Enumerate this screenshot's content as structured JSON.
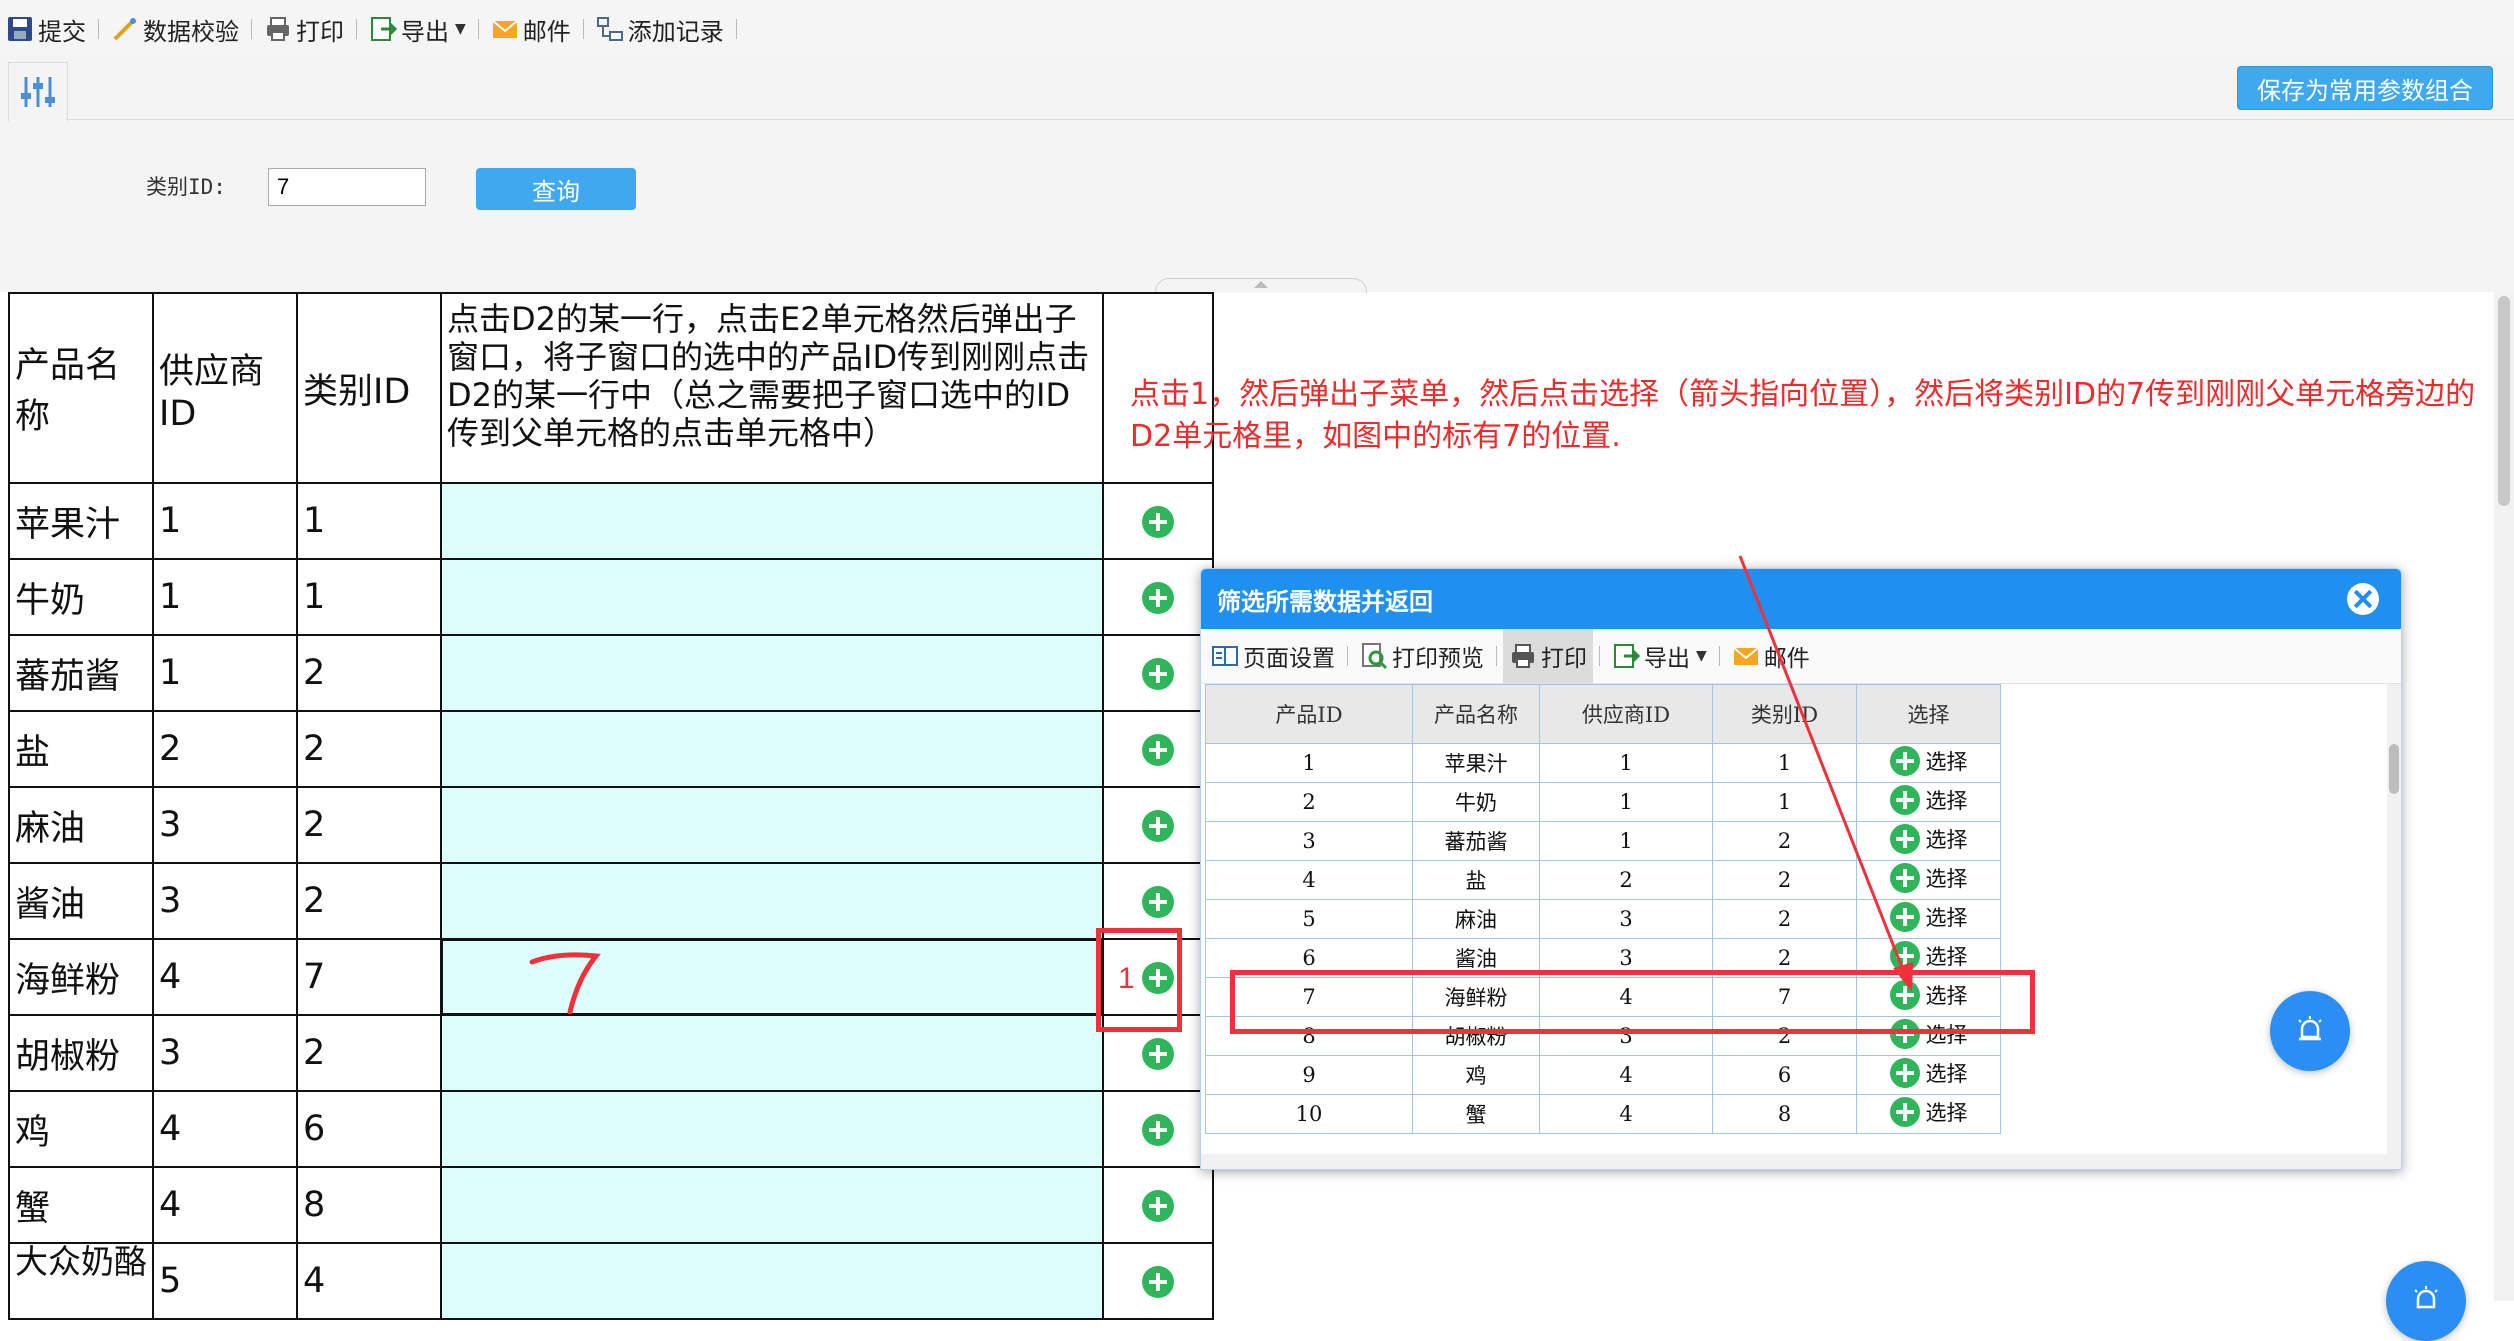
{
  "toolbar": {
    "items": [
      {
        "label": "提交",
        "icon": "save-icon"
      },
      {
        "label": "数据校验",
        "icon": "wand-icon"
      },
      {
        "label": "打印",
        "icon": "printer-icon"
      },
      {
        "label": "导出",
        "icon": "export-icon"
      },
      {
        "label": "邮件",
        "icon": "mail-icon"
      },
      {
        "label": "添加记录",
        "icon": "add-record-icon"
      }
    ]
  },
  "params": {
    "save_label": "保存为常用参数组合",
    "category_label": "类别ID:",
    "category_value": "7",
    "query_label": "查询"
  },
  "main_table": {
    "headers": [
      "产品名称",
      "供应商ID",
      "类别ID",
      "点击D2的某一行，点击E2单元格然后弹出子窗口，将子窗口的选中的产品ID传到刚刚点击D2的某一行中（总之需要把子窗口选中的ID传到父单元格的点击单元格中）",
      ""
    ],
    "rows": [
      [
        "苹果汁",
        "1",
        "1"
      ],
      [
        "牛奶",
        "1",
        "1"
      ],
      [
        "蕃茄酱",
        "1",
        "2"
      ],
      [
        "盐",
        "2",
        "2"
      ],
      [
        "麻油",
        "3",
        "2"
      ],
      [
        "酱油",
        "3",
        "2"
      ],
      [
        "海鲜粉",
        "4",
        "7"
      ],
      [
        "胡椒粉",
        "3",
        "2"
      ],
      [
        "鸡",
        "4",
        "6"
      ],
      [
        "蟹",
        "4",
        "8"
      ],
      [
        "大众奶酪",
        "5",
        "4"
      ]
    ]
  },
  "annotation": {
    "text": "点击1，然后弹出子菜单，然后点击选择（箭头指向位置），然后将类别ID的7传到刚刚父单元格旁边的D2单元格里，如图中的标有7的位置.",
    "marker_number": "1",
    "handwritten": "7"
  },
  "dialog": {
    "title": "筛选所需数据并返回",
    "toolbar": [
      {
        "label": "页面设置",
        "icon": "page-setup-icon"
      },
      {
        "label": "打印预览",
        "icon": "print-preview-icon"
      },
      {
        "label": "打印",
        "icon": "printer-icon"
      },
      {
        "label": "导出",
        "icon": "export-icon"
      },
      {
        "label": "邮件",
        "icon": "mail-icon"
      }
    ],
    "headers": [
      "产品ID",
      "产品名称",
      "供应商ID",
      "类别ID",
      "选择"
    ],
    "select_label": "选择",
    "rows": [
      [
        "1",
        "苹果汁",
        "1",
        "1"
      ],
      [
        "2",
        "牛奶",
        "1",
        "1"
      ],
      [
        "3",
        "蕃茄酱",
        "1",
        "2"
      ],
      [
        "4",
        "盐",
        "2",
        "2"
      ],
      [
        "5",
        "麻油",
        "3",
        "2"
      ],
      [
        "6",
        "酱油",
        "3",
        "2"
      ],
      [
        "7",
        "海鲜粉",
        "4",
        "7"
      ],
      [
        "8",
        "胡椒粉",
        "3",
        "2"
      ],
      [
        "9",
        "鸡",
        "4",
        "6"
      ],
      [
        "10",
        "蟹",
        "4",
        "8"
      ]
    ]
  },
  "colors": {
    "accent": "#3fa9f0",
    "dialog_title": "#1e90f0",
    "highlight_cell": "#ddfffb",
    "annotation_red": "#f02a2a",
    "plus_green": "#2fb65a"
  }
}
